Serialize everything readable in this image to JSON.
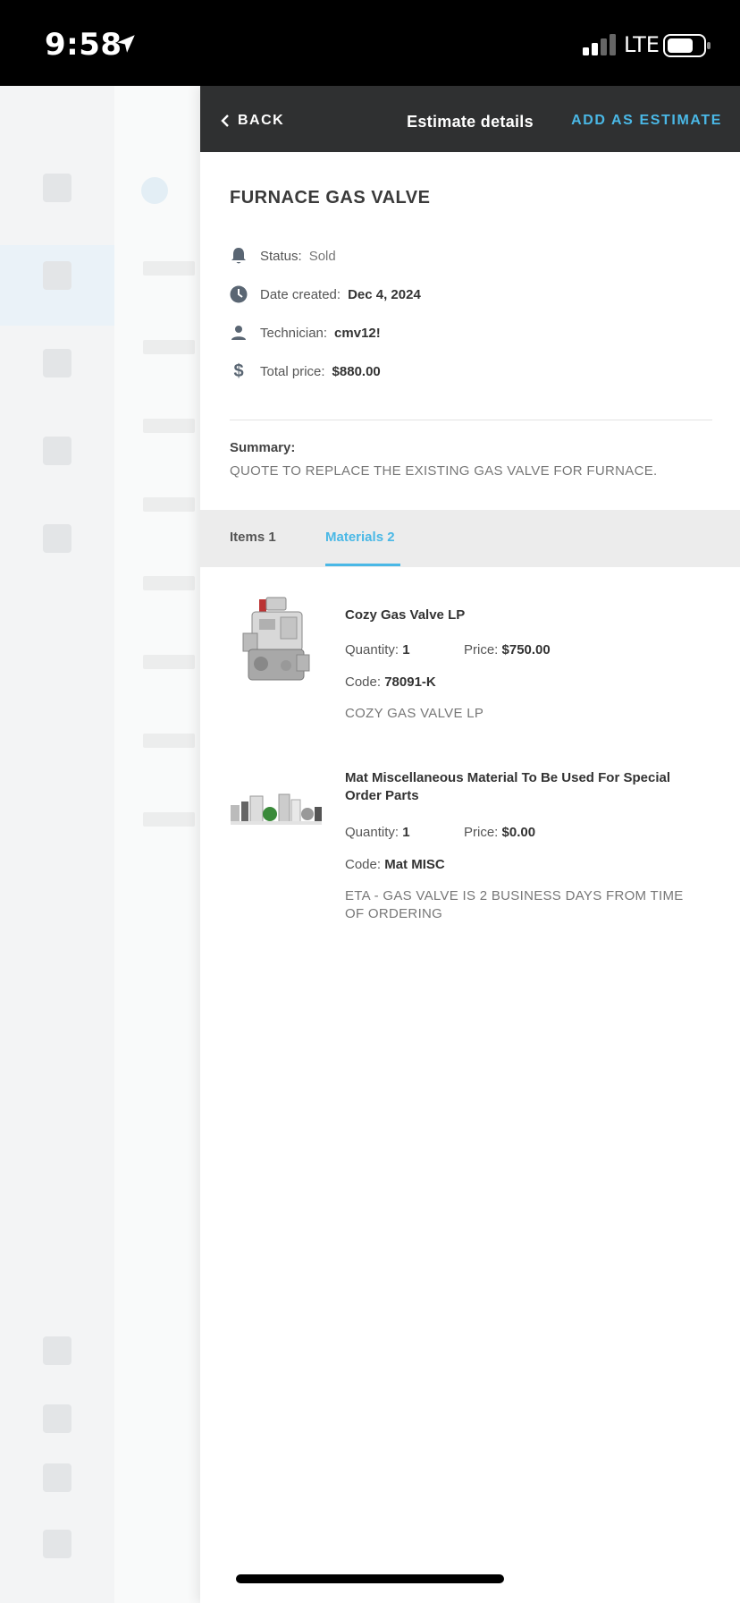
{
  "status_bar": {
    "time": "9:58",
    "network": "LTE",
    "icons": [
      "location-arrow-icon",
      "signal-icon",
      "battery-icon"
    ]
  },
  "header": {
    "back_label": "BACK",
    "title": "Estimate details",
    "action_label": "ADD AS ESTIMATE",
    "accent": "#4ab8e6",
    "background": "#2f3031"
  },
  "estimate": {
    "title": "FURNACE GAS VALVE",
    "status_label": "Status:",
    "status_value": "Sold",
    "date_label": "Date created:",
    "date_value": "Dec 4, 2024",
    "technician_label": "Technician:",
    "technician_value": "cmv12!",
    "total_label": "Total price:",
    "total_value": "$880.00",
    "summary_label": "Summary:",
    "summary_text": "QUOTE TO REPLACE THE EXISTING GAS VALVE FOR FURNACE."
  },
  "tabs": [
    {
      "label": "Items 1",
      "active": false
    },
    {
      "label": "Materials 2",
      "active": true
    }
  ],
  "materials": [
    {
      "name": "Cozy Gas Valve LP",
      "quantity_label": "Quantity:",
      "quantity": "1",
      "price_label": "Price:",
      "price": "$750.00",
      "code_label": "Code:",
      "code": "78091-K",
      "description": "COZY GAS VALVE LP"
    },
    {
      "name": "Mat Miscellaneous Material To Be Used For Special Order Parts",
      "quantity_label": "Quantity:",
      "quantity": "1",
      "price_label": "Price:",
      "price": "$0.00",
      "code_label": "Code:",
      "code": "Mat MISC",
      "description": "ETA - GAS VALVE IS 2 BUSINESS DAYS FROM TIME OF ORDERING"
    }
  ]
}
